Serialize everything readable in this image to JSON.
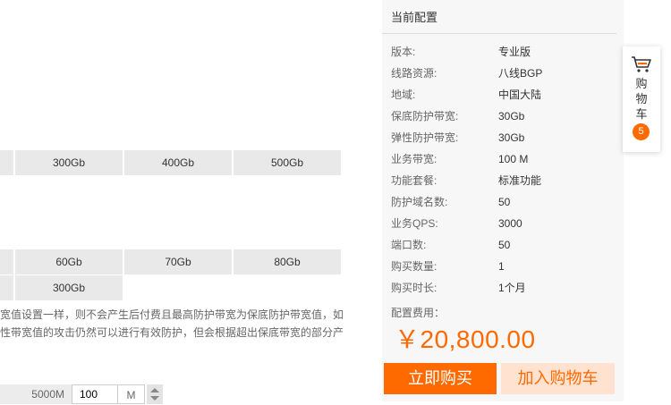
{
  "protection_bandwidth": {
    "options": [
      "300Gb",
      "400Gb",
      "500Gb"
    ]
  },
  "elastic_bandwidth": {
    "options_row1": [
      "60Gb",
      "70Gb",
      "80Gb"
    ],
    "options_row2": [
      "300Gb"
    ]
  },
  "description": {
    "line1": "宽值设置一样，则不会产生后付费且最高防护带宽为保底防护带宽值，如",
    "line2": "性带宽值的攻击仍然可以进行有效防护，但会根据超出保底带宽的部分产"
  },
  "business_bandwidth": {
    "max_label": "5000M",
    "value": "100",
    "unit": "M"
  },
  "config_panel": {
    "title": "当前配置",
    "items": [
      {
        "label": "版本:",
        "value": "专业版"
      },
      {
        "label": "线路资源:",
        "value": "八线BGP"
      },
      {
        "label": "地域:",
        "value": "中国大陆"
      },
      {
        "label": "保底防护带宽:",
        "value": "30Gb"
      },
      {
        "label": "弹性防护带宽:",
        "value": "30Gb"
      },
      {
        "label": "业务带宽:",
        "value": "100 M"
      },
      {
        "label": "功能套餐:",
        "value": "标准功能"
      },
      {
        "label": "防护域名数:",
        "value": "50"
      },
      {
        "label": "业务QPS:",
        "value": "3000"
      },
      {
        "label": "端口数:",
        "value": "50"
      },
      {
        "label": "购买数量:",
        "value": "1"
      },
      {
        "label": "购买时长:",
        "value": "1个月"
      }
    ],
    "fee_label": "配置费用：",
    "price": "￥20,800.00",
    "buy_button": "立即购买",
    "add_cart_button": "加入购物车"
  },
  "cart_float": {
    "label": "购物车",
    "count": "5",
    "icon": "shopping-cart-icon"
  },
  "colors": {
    "accent": "#ff6a00",
    "accent_light": "#ffe2cf",
    "option_bg": "#e9e9e9",
    "panel_bg": "#f7f7f7"
  }
}
